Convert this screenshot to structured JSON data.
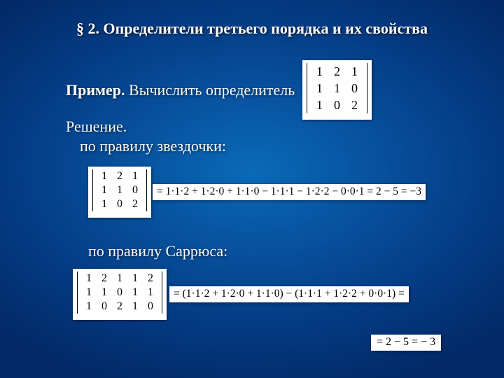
{
  "title": "§ 2. Определители третьего порядка и их свойства",
  "example": {
    "label": "Пример.",
    "text": " Вычислить  определитель"
  },
  "solution": {
    "label": "Решение."
  },
  "star_rule": "по правилу звездочки:",
  "sarrus_rule": "по правилу Саррюса:",
  "matrix": {
    "r1": {
      "c1": "1",
      "c2": "2",
      "c3": "1"
    },
    "r2": {
      "c1": "1",
      "c2": "1",
      "c3": "0"
    },
    "r3": {
      "c1": "1",
      "c2": "0",
      "c3": "2"
    }
  },
  "star_expr": "= 1·1·2 + 1·2·0 + 1·1·0 − 1·1·1 − 1·2·2 − 0·0·1 = 2 − 5 = −3",
  "sarrus_matrix": {
    "r1": {
      "c1": "1",
      "c2": "2",
      "c3": "1",
      "c4": "1",
      "c5": "2"
    },
    "r2": {
      "c1": "1",
      "c2": "1",
      "c3": "0",
      "c4": "1",
      "c5": "1"
    },
    "r3": {
      "c1": "1",
      "c2": "0",
      "c3": "2",
      "c4": "1",
      "c5": "0"
    }
  },
  "sarrus_expr": "= (1·1·2 + 1·2·0 + 1·1·0) − (1·1·1 + 1·2·2 + 0·0·1) =",
  "sarrus_result": "= 2 − 5 = − 3"
}
